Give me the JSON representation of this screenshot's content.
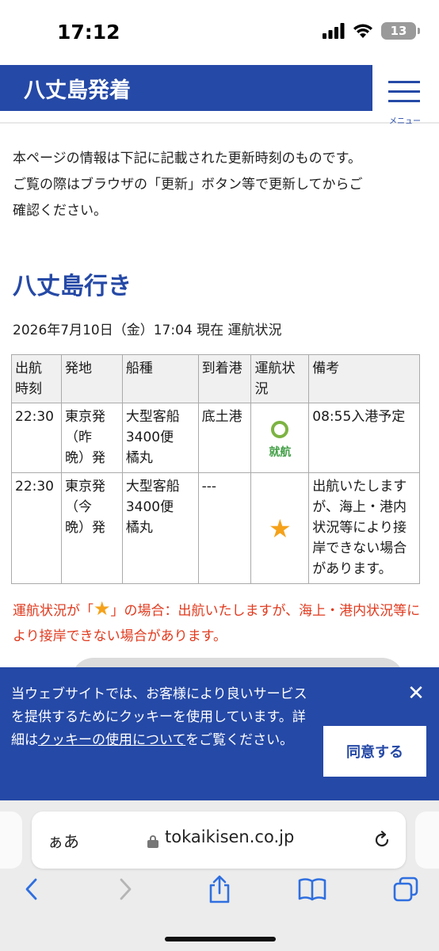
{
  "status_bar": {
    "time": "17:12",
    "battery": "13"
  },
  "header": {
    "title": "八丈島発着",
    "menu_label": "メニュー"
  },
  "intro": {
    "lines": [
      "本ページの情報は下記に記載された更新時刻のものです。",
      "ご覧の際はブラウザの「更新」ボタン等で更新してからご",
      "確認ください。"
    ]
  },
  "section": {
    "title": "八丈島行き",
    "status_time": "2026年7月10日（金）17:04 現在 運航状況"
  },
  "table": {
    "headers": [
      "出航\n時刻",
      "発地",
      "船種",
      "到着港",
      "運航状\n況",
      "備考"
    ],
    "rows": [
      {
        "departure_time": "22:30",
        "origin": "東京発\n（昨\n晩）発",
        "vessel": "大型客船\n3400便\n橘丸",
        "arrival_port": "底土港",
        "status_icon": "ring",
        "status_text": "就航",
        "remarks": "08:55入港予定"
      },
      {
        "departure_time": "22:30",
        "origin": "東京発\n（今\n晩）発",
        "vessel": "大型客船\n3400便\n橘丸",
        "arrival_port": "---",
        "status_icon": "star",
        "status_text": "★",
        "remarks": "出航いたします\nが、海上・港内\n状況等により接\n岸できない場合\nがあります。"
      }
    ]
  },
  "legend": {
    "prefix": "運航状況が「",
    "star": "★",
    "suffix": "」の場合：出航いたしますが、海上・港内状況等により接岸できない場合があります。"
  },
  "cookie": {
    "text_before": "当ウェブサイトでは、お客様により良いサービスを提供するためにクッキーを使用しています。詳細は",
    "link": "クッキーの使用について",
    "text_after": "をご覧ください。",
    "agree": "同意する",
    "close": "✕"
  },
  "browser": {
    "aa": "ぁあ",
    "url": "tokaikisen.co.jp"
  },
  "colors": {
    "brand_blue": "#2549a6",
    "alert_red": "#e03a1e",
    "star_orange": "#f5a21a",
    "status_green": "#43a047"
  }
}
